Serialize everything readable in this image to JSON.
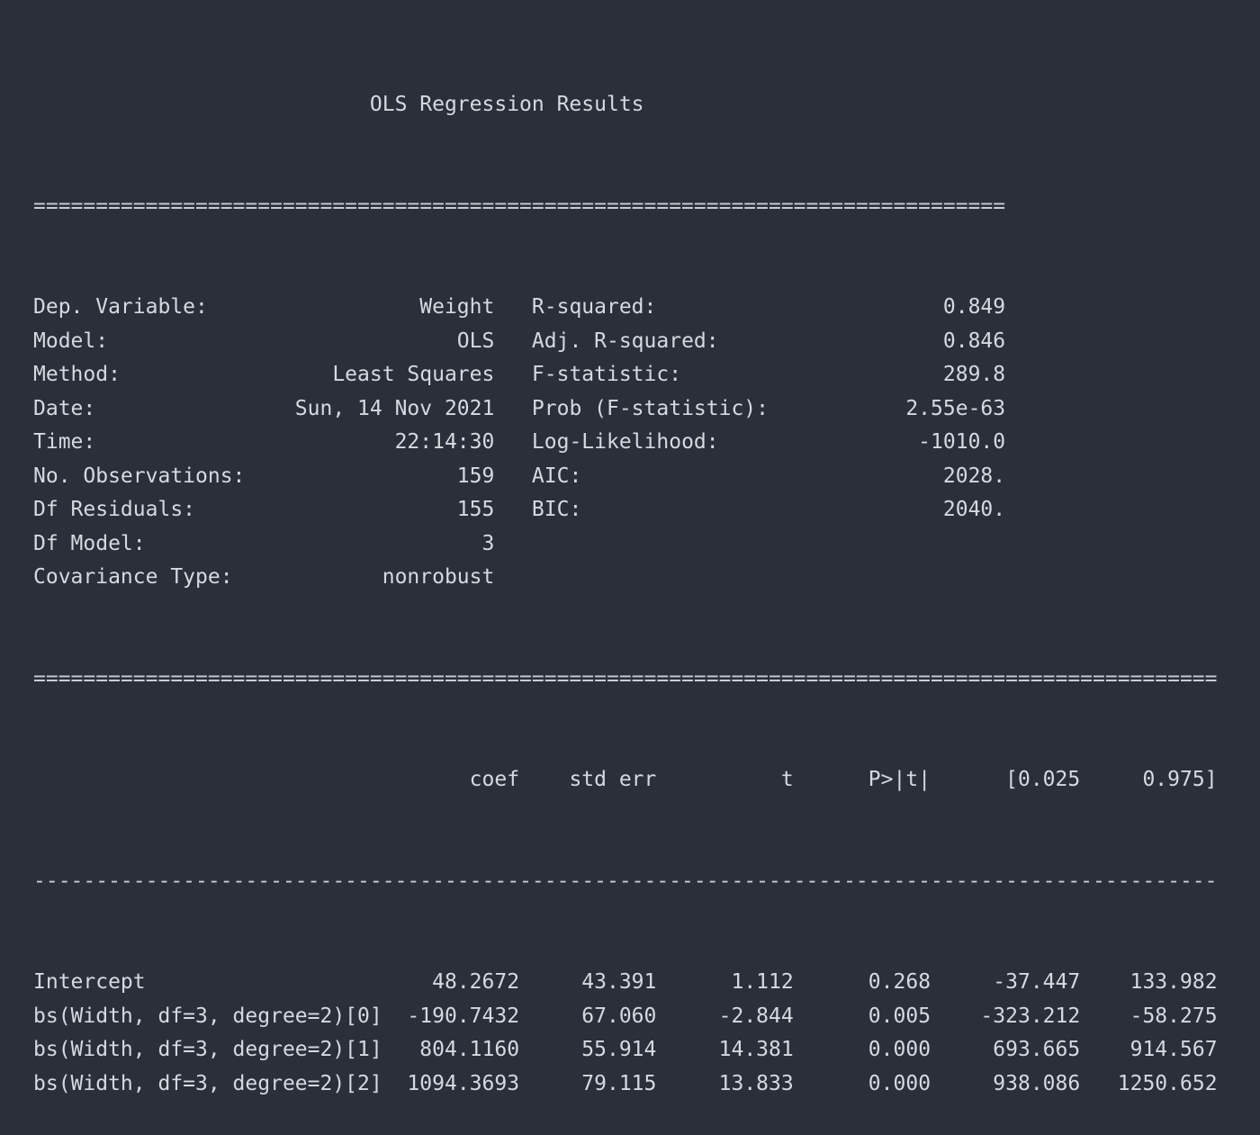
{
  "title": "OLS Regression Results",
  "rule_double_short": "==============================================================================",
  "rule_double_long": "===============================================================================================",
  "rule_single_long": "-----------------------------------------------------------------------------------------------",
  "summary": [
    {
      "l_label": "Dep. Variable:",
      "l_value": "Weight",
      "r_label": "R-squared:",
      "r_value": "0.849"
    },
    {
      "l_label": "Model:",
      "l_value": "OLS",
      "r_label": "Adj. R-squared:",
      "r_value": "0.846"
    },
    {
      "l_label": "Method:",
      "l_value": "Least Squares",
      "r_label": "F-statistic:",
      "r_value": "289.8"
    },
    {
      "l_label": "Date:",
      "l_value": "Sun, 14 Nov 2021",
      "r_label": "Prob (F-statistic):",
      "r_value": "2.55e-63"
    },
    {
      "l_label": "Time:",
      "l_value": "22:14:30",
      "r_label": "Log-Likelihood:",
      "r_value": "-1010.0"
    },
    {
      "l_label": "No. Observations:",
      "l_value": "159",
      "r_label": "AIC:",
      "r_value": "2028."
    },
    {
      "l_label": "Df Residuals:",
      "l_value": "155",
      "r_label": "BIC:",
      "r_value": "2040."
    },
    {
      "l_label": "Df Model:",
      "l_value": "3",
      "r_label": "",
      "r_value": ""
    },
    {
      "l_label": "Covariance Type:",
      "l_value": "nonrobust",
      "r_label": "",
      "r_value": ""
    }
  ],
  "coef_headers": [
    "coef",
    "std err",
    "t",
    "P>|t|",
    "[0.025",
    "0.975]"
  ],
  "coef_rows": [
    {
      "name": "Intercept",
      "values": [
        "48.2672",
        "43.391",
        "1.112",
        "0.268",
        "-37.447",
        "133.982"
      ]
    },
    {
      "name": "bs(Width, df=3, degree=2)[0]",
      "values": [
        "-190.7432",
        "67.060",
        "-2.844",
        "0.005",
        "-323.212",
        "-58.275"
      ]
    },
    {
      "name": "bs(Width, df=3, degree=2)[1]",
      "values": [
        "804.1160",
        "55.914",
        "14.381",
        "0.000",
        "693.665",
        "914.567"
      ]
    },
    {
      "name": "bs(Width, df=3, degree=2)[2]",
      "values": [
        "1094.3693",
        "79.115",
        "13.833",
        "0.000",
        "938.086",
        "1250.652"
      ]
    }
  ]
}
